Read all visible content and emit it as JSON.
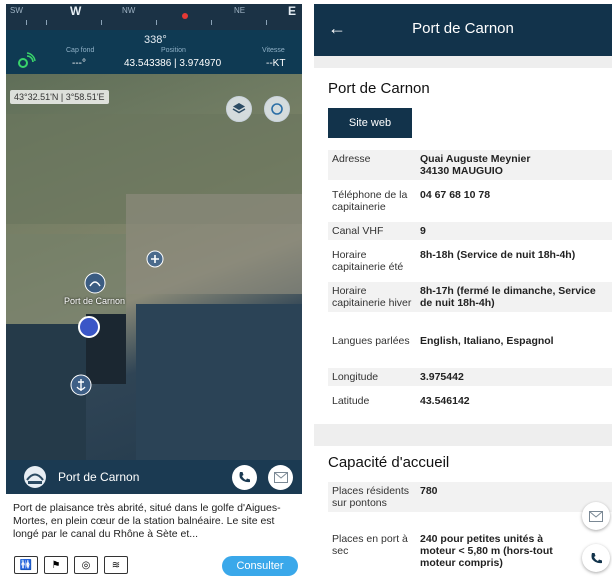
{
  "compass": {
    "labels": [
      "SW",
      "W",
      "NW",
      "NE",
      "E"
    ],
    "heading": "338°"
  },
  "infobar": {
    "cap_label": "Cap fond",
    "cap_value": "---°",
    "position_label": "Position",
    "position_value": "43.543386 | 3.974970",
    "speed_label": "Vitesse",
    "speed_value": "--KT"
  },
  "map": {
    "coordinates": "43°32.51'N | 3°58.51'E",
    "marker_label": "Port de Carnon",
    "icons": [
      "satellite-icon",
      "layers-icon",
      "locate-icon",
      "anchor-icon"
    ]
  },
  "sheet": {
    "title": "Port de Carnon",
    "description": "Port de plaisance très abrité, situé dans le golfe d'Aigues-Mortes, en plein cœur de la station balnéaire. Le site est longé par le canal du Rhône à Sète et...",
    "consult_label": "Consulter"
  },
  "detail": {
    "topbar_title": "Port de Carnon",
    "title": "Port de Carnon",
    "web_button": "Site web",
    "rows": [
      {
        "key": "Adresse",
        "value": "Quai Auguste Meynier\n34130 MAUGUIO"
      },
      {
        "key": "Téléphone de la capitainerie",
        "value": "04 67 68 10 78"
      },
      {
        "key": "Canal VHF",
        "value": "9"
      },
      {
        "key": "Horaire capitainerie été",
        "value": "8h-18h (Service de nuit 18h-4h)"
      },
      {
        "key": "Horaire capitainerie hiver",
        "value": "8h-17h (fermé le dimanche, Service de nuit 18h-4h)"
      },
      {
        "key": "Langues parlées",
        "value": "English, Italiano, Espagnol"
      },
      {
        "key": "Longitude",
        "value": "3.975442"
      },
      {
        "key": "Latitude",
        "value": "43.546142"
      }
    ],
    "capacity_title": "Capacité d'accueil",
    "capacity_rows": [
      {
        "key": "Places résidents sur pontons",
        "value": "780"
      },
      {
        "key": "Places en port à sec",
        "value": "240 pour petites unités à moteur < 5,80 m (hors-tout moteur compris)"
      }
    ]
  },
  "colors": {
    "nav_dark": "#12334b",
    "accent_blue": "#3aa8ea"
  }
}
